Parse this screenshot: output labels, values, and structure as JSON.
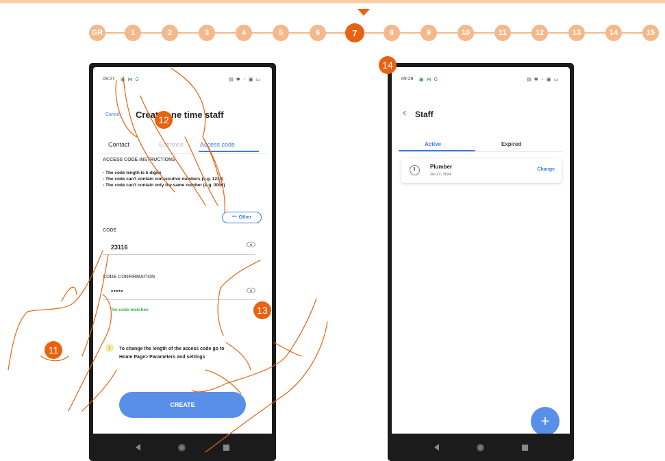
{
  "step_nav": {
    "steps": [
      "GR",
      "1",
      "2",
      "3",
      "4",
      "5",
      "6",
      "7",
      "8",
      "9",
      "10",
      "11",
      "12",
      "13",
      "14",
      "15"
    ],
    "active_step": "7"
  },
  "colors": {
    "accent_orange": "#e8620f",
    "step_light_orange": "#f5b88a",
    "app_blue": "#3d7be8",
    "button_blue": "#5a8fe8",
    "success_green": "#2fb34e"
  },
  "left_phone": {
    "status_time": "09:27",
    "status_left_icons": "▣ ⋈ G",
    "status_right_icons": "▤ ✱ ◔ ▣ ▭",
    "cancel": "Cancel",
    "title": "Create one time staff",
    "tabs": [
      "Contact",
      "Entrance",
      "Access code"
    ],
    "active_tab": "Access code",
    "instructions_title": "ACCESS CODE INSTRUCTIONS",
    "instructions": [
      "- The code length is 5 digits",
      "- The code can't contain consecutive numbers (e.g. 1234)",
      "- The code can't contain only the same number (e.g. 0000)"
    ],
    "other_button": "Other",
    "other_icon": "***",
    "code_label": "CODE",
    "code_value": "23116",
    "confirm_label": "CODE CONFIRMATION",
    "confirm_value": "*****",
    "match_message": "The code matches",
    "info_icon": "i",
    "info_line1": "To change the length of the access code go to",
    "info_line2": "Home Page> Parameters and settings",
    "create_button": "CREATE"
  },
  "right_phone": {
    "status_time": "09:28",
    "status_left_icons": "▣ ⋈ G",
    "status_right_icons": "▤ ✱ ◔ ▣ ▭",
    "back_icon": "‹",
    "title": "Staff",
    "tabs": [
      "Active",
      "Expired"
    ],
    "active_tab": "Active",
    "staff_list": [
      {
        "name": "Plumber",
        "date": "Jul 27, 2024",
        "action": "Change"
      }
    ],
    "fab_label": "+"
  },
  "callouts": [
    "11",
    "12",
    "13",
    "14"
  ]
}
